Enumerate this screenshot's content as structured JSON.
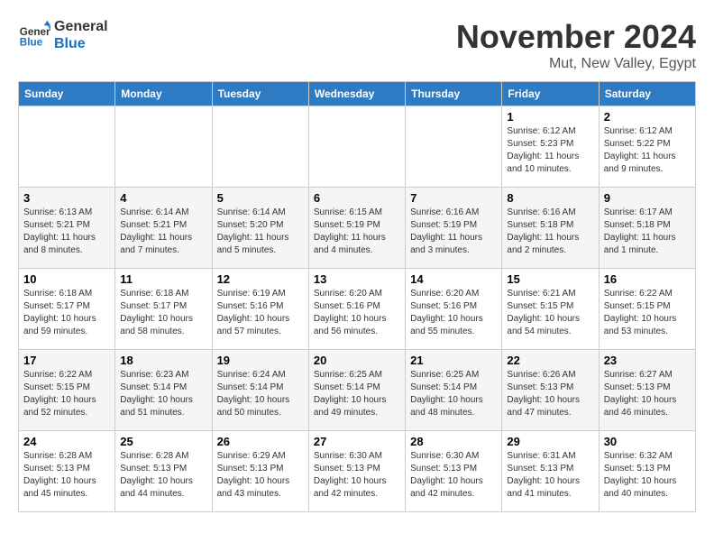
{
  "logo": {
    "line1": "General",
    "line2": "Blue"
  },
  "title": "November 2024",
  "location": "Mut, New Valley, Egypt",
  "weekdays": [
    "Sunday",
    "Monday",
    "Tuesday",
    "Wednesday",
    "Thursday",
    "Friday",
    "Saturday"
  ],
  "weeks": [
    [
      {
        "day": "",
        "info": ""
      },
      {
        "day": "",
        "info": ""
      },
      {
        "day": "",
        "info": ""
      },
      {
        "day": "",
        "info": ""
      },
      {
        "day": "",
        "info": ""
      },
      {
        "day": "1",
        "info": "Sunrise: 6:12 AM\nSunset: 5:23 PM\nDaylight: 11 hours and 10 minutes."
      },
      {
        "day": "2",
        "info": "Sunrise: 6:12 AM\nSunset: 5:22 PM\nDaylight: 11 hours and 9 minutes."
      }
    ],
    [
      {
        "day": "3",
        "info": "Sunrise: 6:13 AM\nSunset: 5:21 PM\nDaylight: 11 hours and 8 minutes."
      },
      {
        "day": "4",
        "info": "Sunrise: 6:14 AM\nSunset: 5:21 PM\nDaylight: 11 hours and 7 minutes."
      },
      {
        "day": "5",
        "info": "Sunrise: 6:14 AM\nSunset: 5:20 PM\nDaylight: 11 hours and 5 minutes."
      },
      {
        "day": "6",
        "info": "Sunrise: 6:15 AM\nSunset: 5:19 PM\nDaylight: 11 hours and 4 minutes."
      },
      {
        "day": "7",
        "info": "Sunrise: 6:16 AM\nSunset: 5:19 PM\nDaylight: 11 hours and 3 minutes."
      },
      {
        "day": "8",
        "info": "Sunrise: 6:16 AM\nSunset: 5:18 PM\nDaylight: 11 hours and 2 minutes."
      },
      {
        "day": "9",
        "info": "Sunrise: 6:17 AM\nSunset: 5:18 PM\nDaylight: 11 hours and 1 minute."
      }
    ],
    [
      {
        "day": "10",
        "info": "Sunrise: 6:18 AM\nSunset: 5:17 PM\nDaylight: 10 hours and 59 minutes."
      },
      {
        "day": "11",
        "info": "Sunrise: 6:18 AM\nSunset: 5:17 PM\nDaylight: 10 hours and 58 minutes."
      },
      {
        "day": "12",
        "info": "Sunrise: 6:19 AM\nSunset: 5:16 PM\nDaylight: 10 hours and 57 minutes."
      },
      {
        "day": "13",
        "info": "Sunrise: 6:20 AM\nSunset: 5:16 PM\nDaylight: 10 hours and 56 minutes."
      },
      {
        "day": "14",
        "info": "Sunrise: 6:20 AM\nSunset: 5:16 PM\nDaylight: 10 hours and 55 minutes."
      },
      {
        "day": "15",
        "info": "Sunrise: 6:21 AM\nSunset: 5:15 PM\nDaylight: 10 hours and 54 minutes."
      },
      {
        "day": "16",
        "info": "Sunrise: 6:22 AM\nSunset: 5:15 PM\nDaylight: 10 hours and 53 minutes."
      }
    ],
    [
      {
        "day": "17",
        "info": "Sunrise: 6:22 AM\nSunset: 5:15 PM\nDaylight: 10 hours and 52 minutes."
      },
      {
        "day": "18",
        "info": "Sunrise: 6:23 AM\nSunset: 5:14 PM\nDaylight: 10 hours and 51 minutes."
      },
      {
        "day": "19",
        "info": "Sunrise: 6:24 AM\nSunset: 5:14 PM\nDaylight: 10 hours and 50 minutes."
      },
      {
        "day": "20",
        "info": "Sunrise: 6:25 AM\nSunset: 5:14 PM\nDaylight: 10 hours and 49 minutes."
      },
      {
        "day": "21",
        "info": "Sunrise: 6:25 AM\nSunset: 5:14 PM\nDaylight: 10 hours and 48 minutes."
      },
      {
        "day": "22",
        "info": "Sunrise: 6:26 AM\nSunset: 5:13 PM\nDaylight: 10 hours and 47 minutes."
      },
      {
        "day": "23",
        "info": "Sunrise: 6:27 AM\nSunset: 5:13 PM\nDaylight: 10 hours and 46 minutes."
      }
    ],
    [
      {
        "day": "24",
        "info": "Sunrise: 6:28 AM\nSunset: 5:13 PM\nDaylight: 10 hours and 45 minutes."
      },
      {
        "day": "25",
        "info": "Sunrise: 6:28 AM\nSunset: 5:13 PM\nDaylight: 10 hours and 44 minutes."
      },
      {
        "day": "26",
        "info": "Sunrise: 6:29 AM\nSunset: 5:13 PM\nDaylight: 10 hours and 43 minutes."
      },
      {
        "day": "27",
        "info": "Sunrise: 6:30 AM\nSunset: 5:13 PM\nDaylight: 10 hours and 42 minutes."
      },
      {
        "day": "28",
        "info": "Sunrise: 6:30 AM\nSunset: 5:13 PM\nDaylight: 10 hours and 42 minutes."
      },
      {
        "day": "29",
        "info": "Sunrise: 6:31 AM\nSunset: 5:13 PM\nDaylight: 10 hours and 41 minutes."
      },
      {
        "day": "30",
        "info": "Sunrise: 6:32 AM\nSunset: 5:13 PM\nDaylight: 10 hours and 40 minutes."
      }
    ]
  ]
}
